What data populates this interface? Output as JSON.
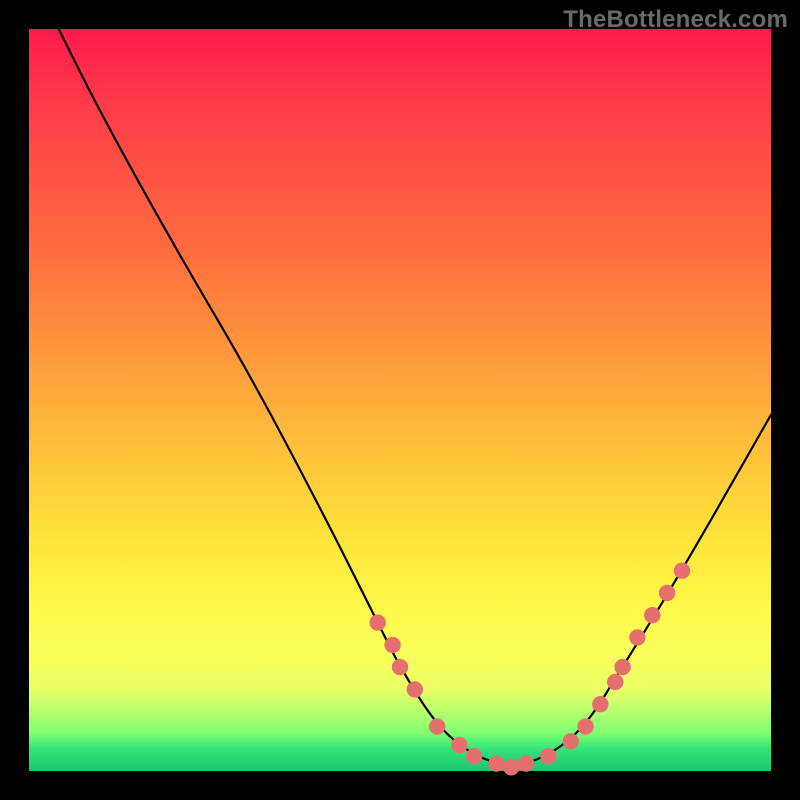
{
  "watermark": "TheBottleneck.com",
  "chart_data": {
    "type": "line",
    "title": "",
    "xlabel": "",
    "ylabel": "",
    "xlim": [
      0,
      100
    ],
    "ylim": [
      0,
      100
    ],
    "curve": {
      "name": "bottleneck-curve",
      "x": [
        4,
        10,
        20,
        30,
        40,
        47,
        50,
        55,
        60,
        65,
        70,
        75,
        80,
        88,
        100
      ],
      "y": [
        100,
        88,
        70,
        53,
        34,
        20,
        14,
        6,
        2,
        0.5,
        2,
        6,
        14,
        27,
        48
      ]
    },
    "markers": {
      "name": "curve-markers",
      "color": "#e56f6f",
      "radius_pct": 1.1,
      "x": [
        47,
        49,
        50,
        52,
        55,
        58,
        60,
        63,
        65,
        67,
        70,
        73,
        75,
        77,
        79,
        80,
        82,
        84,
        86,
        88
      ],
      "y": [
        20,
        17,
        14,
        11,
        6,
        3.5,
        2,
        1,
        0.5,
        1,
        2,
        4,
        6,
        9,
        12,
        14,
        18,
        21,
        24,
        27
      ]
    },
    "background": {
      "type": "vertical-gradient",
      "top_color": "#ff1a4b",
      "mid_color": "#fff94a",
      "bottom_color": "#1dc66e"
    }
  }
}
